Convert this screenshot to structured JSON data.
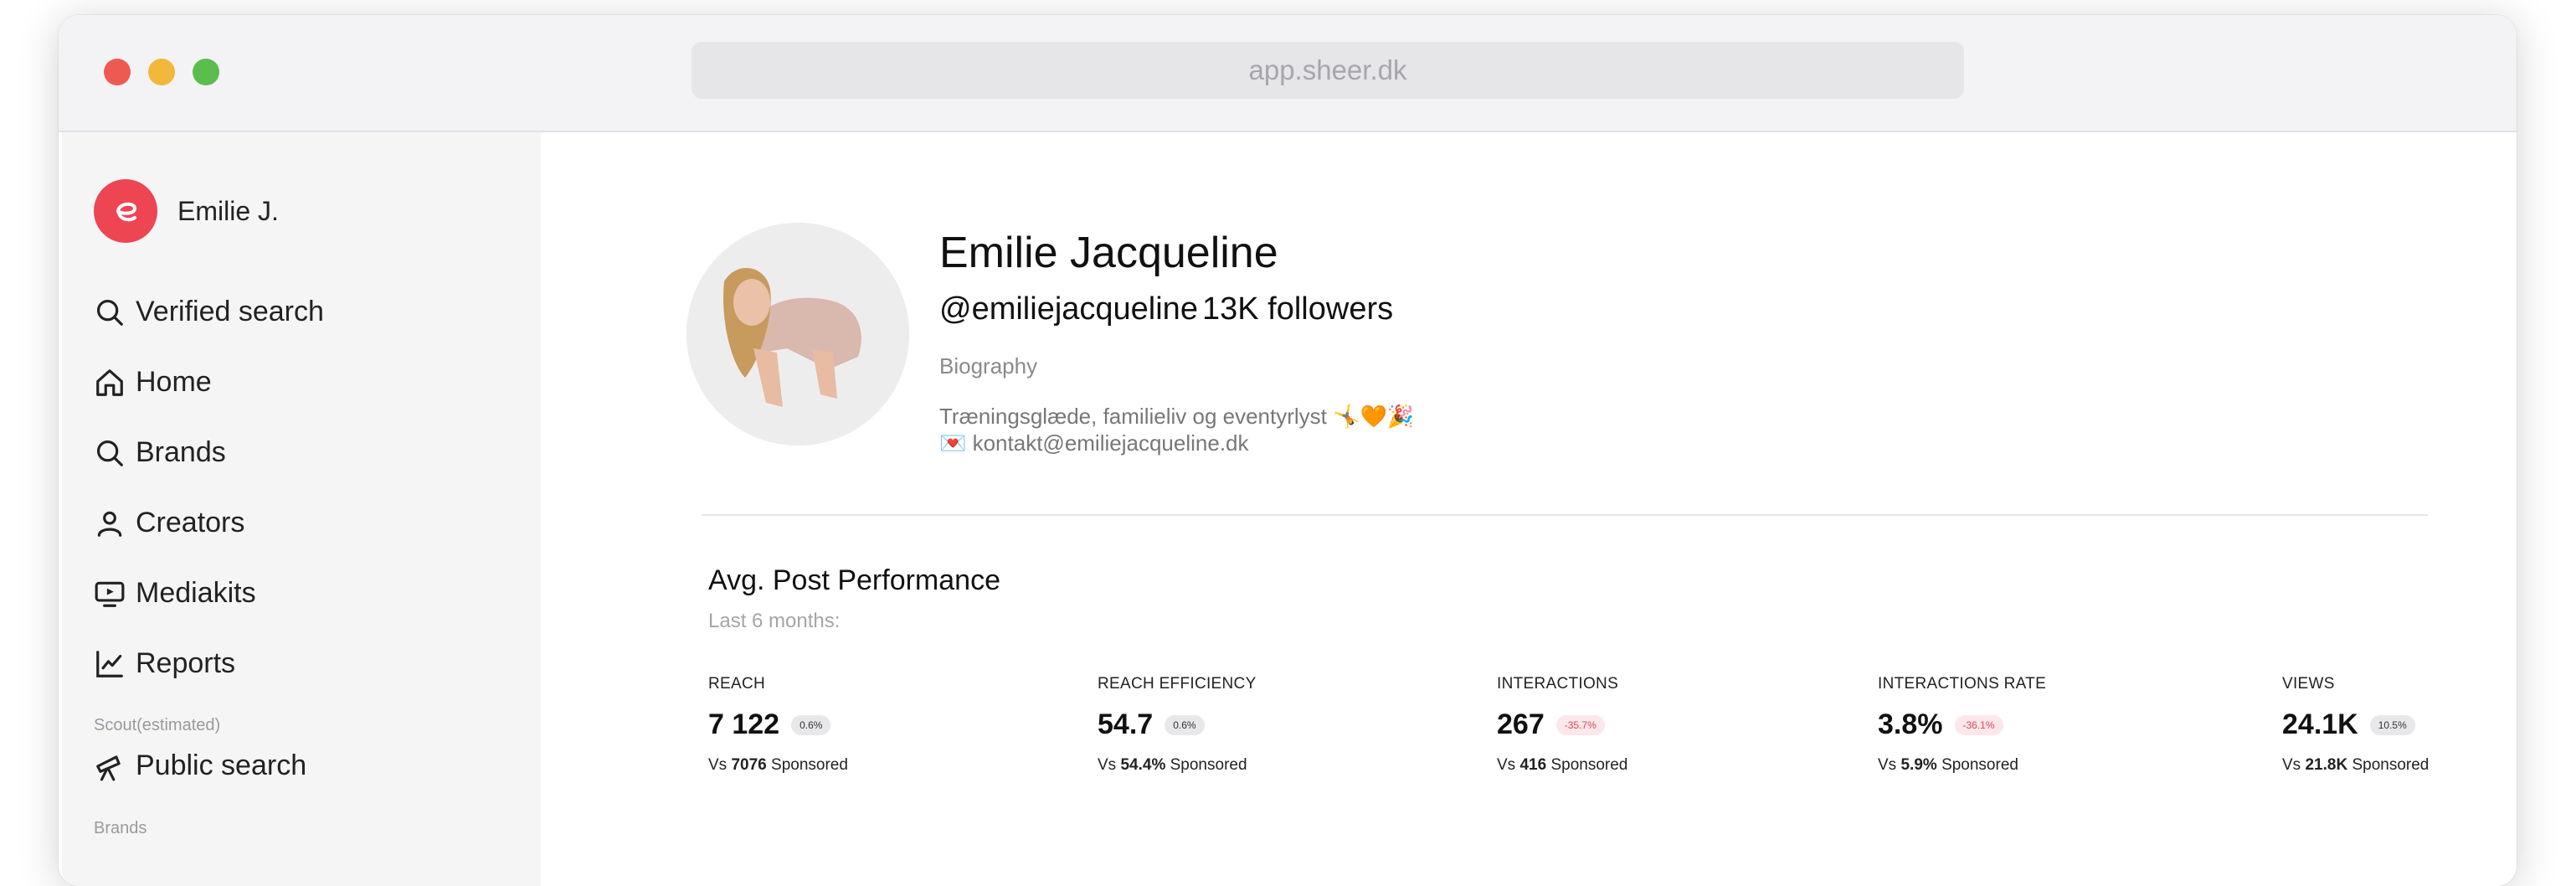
{
  "browser": {
    "url": "app.sheer.dk"
  },
  "sidebar": {
    "user_name": "Emilie J.",
    "items": [
      {
        "label": "Verified search",
        "icon": "search-icon"
      },
      {
        "label": "Home",
        "icon": "home-icon"
      },
      {
        "label": "Brands",
        "icon": "search-icon"
      },
      {
        "label": "Creators",
        "icon": "user-icon"
      },
      {
        "label": "Mediakits",
        "icon": "play-screen-icon"
      },
      {
        "label": "Reports",
        "icon": "chart-line-icon"
      }
    ],
    "scout_label": "Scout(estimated)",
    "public_search": {
      "label": "Public search",
      "icon": "telescope-icon"
    },
    "brands_label": "Brands"
  },
  "profile": {
    "name": "Emilie Jacqueline",
    "handle": "@emiliejacqueline",
    "followers": "13K followers",
    "bio_label": "Biography",
    "bio_line1": "Træningsglæde, familieliv og eventyrlyst 🤸🧡🎉",
    "bio_line2": "💌 kontakt@emiliejacqueline.dk"
  },
  "performance": {
    "title": "Avg. Post Performance",
    "subtitle": "Last 6 months:",
    "metrics": [
      {
        "label": "REACH",
        "value": "7 122",
        "badge": "0.6%",
        "badge_status": "neutral",
        "compare_prefix": "Vs",
        "compare_value": "7076",
        "compare_suffix": "Sponsored"
      },
      {
        "label": "REACH EFFICIENCY",
        "value": "54.7",
        "badge": "0.6%",
        "badge_status": "neutral",
        "compare_prefix": "Vs",
        "compare_value": "54.4%",
        "compare_suffix": "Sponsored"
      },
      {
        "label": "INTERACTIONS",
        "value": "267",
        "badge": "-35.7%",
        "badge_status": "negative",
        "compare_prefix": "Vs",
        "compare_value": "416",
        "compare_suffix": "Sponsored"
      },
      {
        "label": "INTERACTIONS RATE",
        "value": "3.8%",
        "badge": "-36.1%",
        "badge_status": "negative",
        "compare_prefix": "Vs",
        "compare_value": "5.9%",
        "compare_suffix": "Sponsored"
      },
      {
        "label": "VIEWS",
        "value": "24.1K",
        "badge": "10.5%",
        "badge_status": "neutral",
        "compare_prefix": "Vs",
        "compare_value": "21.8K",
        "compare_suffix": "Sponsored"
      }
    ]
  },
  "colors": {
    "accent": "#ee4553",
    "negative": "#d4485a"
  }
}
